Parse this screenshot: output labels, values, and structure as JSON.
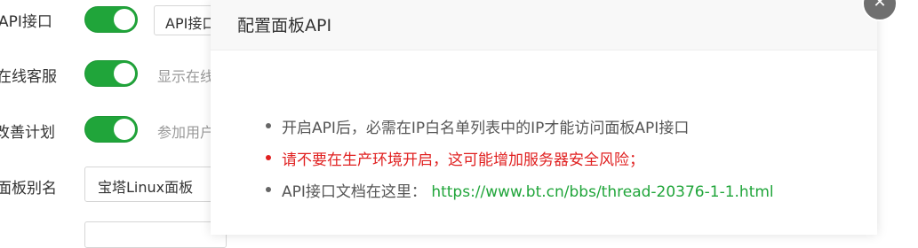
{
  "settings": {
    "rows": [
      {
        "label": "API接口",
        "button_label": "API接口"
      },
      {
        "label": "在线客服",
        "hint": "显示在线"
      },
      {
        "label": "改善计划",
        "hint": "参加用户"
      },
      {
        "label": "面板别名",
        "input_value": "宝塔Linux面板"
      }
    ]
  },
  "dialog": {
    "title": "配置面板API",
    "close_symbol": "✕",
    "notes": [
      {
        "text": "开启API后，必需在IP白名单列表中的IP才能访问面板API接口"
      },
      {
        "text": "请不要在生产环境开启，这可能增加服务器安全风险；"
      },
      {
        "prefix": "API接口文档在这里：",
        "link_text": "https://www.bt.cn/bbs/thread-20376-1-1.html"
      }
    ]
  },
  "colors": {
    "accent_green": "#20a53a",
    "warning_red": "#e02020"
  }
}
